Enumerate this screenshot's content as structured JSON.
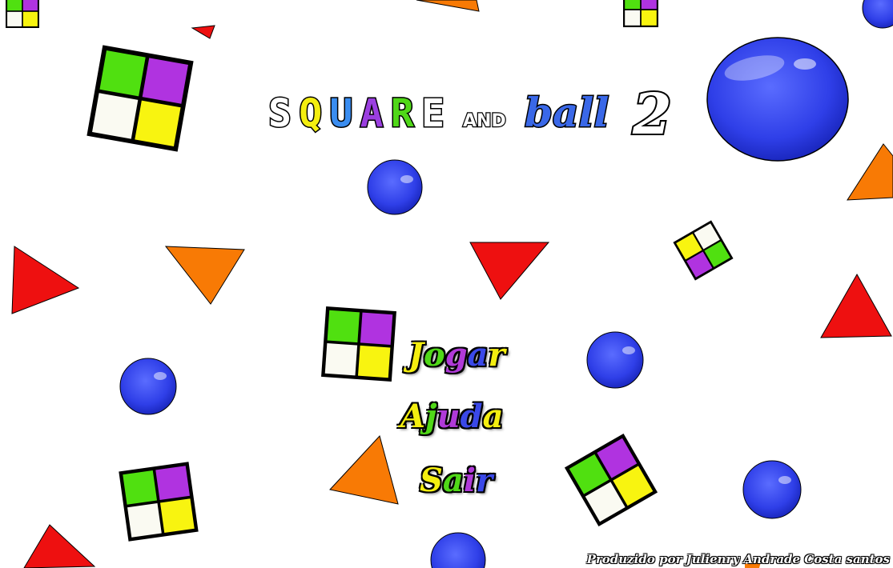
{
  "title": {
    "word1": "SQUARE",
    "word1_colors": [
      "#ffffff",
      "#f4ee10",
      "#3a8df0",
      "#9b3fe0",
      "#50d818",
      "#ffffff"
    ],
    "word2": "AND",
    "word3": "ball",
    "word4": "2"
  },
  "menu": {
    "play": "Jogar",
    "help": "Ajuda",
    "exit": "Sair",
    "letter_colors": [
      "#f4ee10",
      "#50d818",
      "#b03ad8",
      "#3a48e8"
    ]
  },
  "credit": "Produzido por Julienry Andrade Costa santos",
  "colors": {
    "green": "#50e010",
    "purple": "#b033e0",
    "white": "#fafaf2",
    "yellow": "#f8f410",
    "blue": "#3040e8",
    "red": "#ee1010",
    "orange": "#f87a05"
  }
}
